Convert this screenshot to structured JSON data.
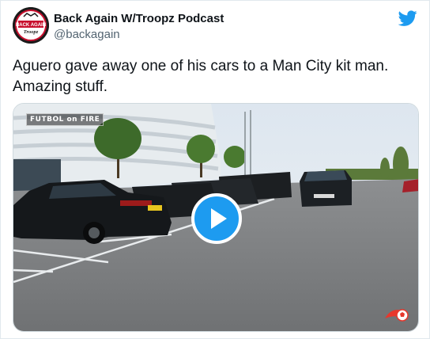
{
  "header": {
    "display_name": "Back Again W/Troopz Podcast",
    "handle": "@backagain",
    "avatar_text_top": "BACK AGAIN",
    "avatar_text_bottom": "Troopz"
  },
  "tweet": {
    "text_line1": "Aguero gave away one of his cars to a Man City kit man.",
    "text_line2": "Amazing stuff."
  },
  "media": {
    "type": "video",
    "overlay_label": "FUTBOL on FIRE",
    "play_icon": "play-icon"
  },
  "colors": {
    "accent": "#1d9bf0",
    "text_primary": "#0f1419",
    "text_secondary": "#536471"
  },
  "icons": [
    "twitter-bird-icon",
    "play-icon",
    "avatar-logo",
    "channel-logo-icon"
  ]
}
